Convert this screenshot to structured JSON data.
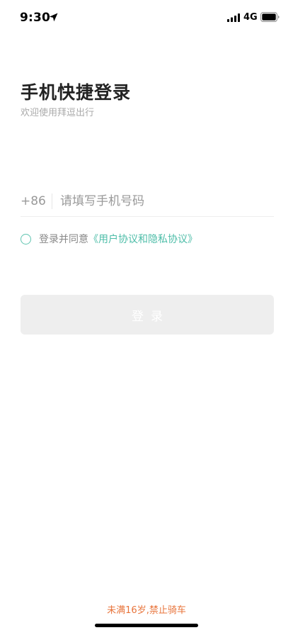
{
  "status_bar": {
    "time": "9:30",
    "network": "4G",
    "icons": [
      "location-arrow-icon",
      "signal-bars-icon",
      "battery-icon"
    ]
  },
  "header": {
    "title": "手机快捷登录",
    "subtitle": "欢迎使用拜逗出行"
  },
  "phone": {
    "country_code": "+86",
    "placeholder": "请填写手机号码",
    "value": ""
  },
  "agreement": {
    "checked": false,
    "prefix": "登录并同意",
    "link_text": "《用户协议和隐私协议》"
  },
  "login_button": {
    "label": "登录",
    "enabled": false
  },
  "footer": {
    "notice": "未满16岁,禁止骑车"
  },
  "colors": {
    "accent": "#4dbda8",
    "warning": "#e8743b",
    "button_disabled": "#eeeeee",
    "title": "#222222"
  }
}
